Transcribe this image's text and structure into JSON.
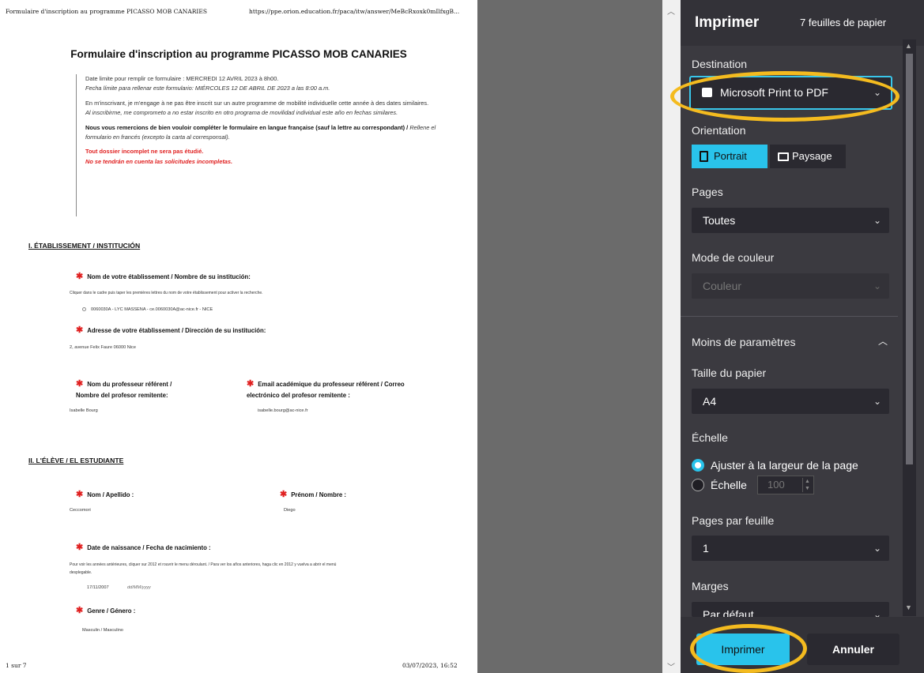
{
  "document": {
    "header_left": "Formulaire d'inscription au programme PICASSO MOB CANARIES",
    "header_right": "https://ppe.orion.education.fr/paca/itw/answer/MeBcRxoxk0mIlfxgB...",
    "title": "Formulaire d'inscription au programme PICASSO MOB CANARIES",
    "intro": {
      "p1_a": "Date limite pour remplir ce formulaire : MERCREDI 12 AVRIL 2023 à 8h00.",
      "p1_b": "Fecha límite para rellenar este formulario: MIÉRCOLES 12 DE ABRIL DE 2023 a las 8:00 a.m.",
      "p2_a": "En m'inscrivant, je m'engage à ne pas être inscrit sur un autre programme de mobilité individuelle cette année à des dates similaires.",
      "p2_b": "Al inscribirme, me comprometo a no estar inscrito en otro programa de movilidad individual este año en fechas similares.",
      "p3_a": "Nous vous remercions de bien vouloir compléter le formulaire en langue française (sauf la lettre au correspondant) /",
      "p3_b": "Rellene el formulario en francés (excepto la carta al corresponsal).",
      "p4_a": "Tout dossier incomplet ne sera pas étudié.",
      "p4_b": "No se tendrán en cuenta las solicitudes incompletas."
    },
    "section1": "I. ÉTABLISSEMENT / INSTITUCIÓN",
    "q_etab": "Nom de votre établissement / Nombre de su institución:",
    "q_etab_hint": "Cliquer dans le cadre puis taper les premières lettres du nom de votre établissement pour activer la recherche.",
    "a_etab": "0060030A - LYC MASSENA - ce.0060030A@ac-nice.fr - NICE",
    "q_adresse": "Adresse de votre établissement / Dirección de su institución:",
    "a_adresse": "2, avenue Felix Faure 06000 Nice",
    "q_prof_a": "Nom du professeur référent /",
    "q_prof_b": "Nombre del profesor remitente:",
    "a_prof": "Isabelle Bourg",
    "q_email_a": "Email académique du professeur référent / Correo",
    "q_email_b": "electrónico del profesor remitente :",
    "a_email": "isabelle.bourg@ac-nice.fr",
    "section2": "II. L'ÉLÈVE / EL ESTUDIANTE",
    "q_nom": "Nom / Apellido :",
    "a_nom": "Ceccomori",
    "q_prenom": "Prénom / Nombre :",
    "a_prenom": "Diego",
    "q_naissance": "Date de naissance / Fecha de nacimiento :",
    "q_naissance_hint_a": "Pour voir les années antérieures, cliquer sur 2012 et rouvrir le menu déroulant. / Para ver los años anteriores, haga clic en 2012 y vuelva a abrir el menú",
    "q_naissance_hint_b": "desplegable.",
    "a_naissance": "17/11/2007",
    "a_naissance_fmt": "dd/MM/yyyy",
    "q_genre": "Genre / Género :",
    "a_genre": "Masculin / Masculino",
    "footer_left": "1 sur 7",
    "footer_right": "03/07/2023, 16:52"
  },
  "dialog": {
    "title": "Imprimer",
    "sheets": "7 feuilles de papier",
    "destination_label": "Destination",
    "destination_value": "Microsoft Print to PDF",
    "destination_icon": "printer-icon",
    "orientation_label": "Orientation",
    "orientation_portrait": "Portrait",
    "orientation_landscape": "Paysage",
    "orientation_selected": "Portrait",
    "pages_label": "Pages",
    "pages_value": "Toutes",
    "color_label": "Mode de couleur",
    "color_value": "Couleur",
    "less_settings": "Moins de paramètres",
    "paper_label": "Taille du papier",
    "paper_value": "A4",
    "scale_label": "Échelle",
    "scale_fit": "Ajuster à la largeur de la page",
    "scale_custom": "Échelle",
    "scale_value": "100",
    "pps_label": "Pages par feuille",
    "pps_value": "1",
    "margins_label": "Marges",
    "margins_value": "Par défaut",
    "print_button": "Imprimer",
    "cancel_button": "Annuler"
  },
  "colors": {
    "accent": "#29c3eb",
    "highlight": "#f4bb1f",
    "dialog_bg": "#3b3a40",
    "required_star": "#e02020"
  }
}
